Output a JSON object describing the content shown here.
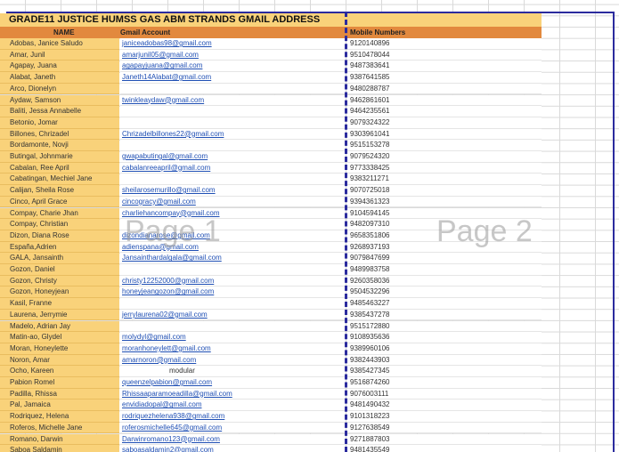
{
  "title": "GRADE11 JUSTICE HUMSS GAS ABM STRANDS GMAIL ADDRESS",
  "headers": {
    "name": "NAME",
    "gmail": "Gmail Account",
    "mobile": "Mobile Numbers"
  },
  "watermarks": {
    "page1": "Page 1",
    "page2": "Page 2"
  },
  "rows": [
    {
      "name": "Adobas, Janice Saludo",
      "gmail": "janiceadobas98@gmail.com",
      "mobile": "9120140896"
    },
    {
      "name": "Amar, Junil",
      "gmail": "amarjunil05@gmail.com",
      "mobile": "9510478044"
    },
    {
      "name": "Agapay, Juana",
      "gmail": "agapayjuana@gmail.com",
      "mobile": "9487383641"
    },
    {
      "name": "Alabat, Janeth",
      "gmail": "Janeth14Alabat@gmail.com",
      "mobile": "9387641585"
    },
    {
      "name": "Arco, Dionelyn",
      "gmail": "",
      "mobile": "9480288787"
    },
    {
      "name": "Aydaw, Samson",
      "gmail": "twinkleaydaw@gmail.com",
      "mobile": "9462861601"
    },
    {
      "name": "Baliti, Jessa Annabelle",
      "gmail": "",
      "mobile": "9464235561"
    },
    {
      "name": "Betonio, Jomar",
      "gmail": "",
      "mobile": "9079324322"
    },
    {
      "name": "Billones, Chrizadel",
      "gmail": "Chrizadelbillones22@gmail.com",
      "mobile": "9303961041"
    },
    {
      "name": "Bordamonte, Novji",
      "gmail": "",
      "mobile": "9515153278"
    },
    {
      "name": "Butingal, Johnmarie",
      "gmail": "gwapabutingal@gmail.com",
      "mobile": "9079524320"
    },
    {
      "name": "Cabalan, Ree April",
      "gmail": "cabalanreeapril@gmail.com",
      "mobile": "9773338425"
    },
    {
      "name": "Cabatingan, Mechiel Jane",
      "gmail": "",
      "mobile": "9383211271"
    },
    {
      "name": "Calijan, Sheila Rose",
      "gmail": "sheilarosemurillo@gmail.com",
      "mobile": "9070725018"
    },
    {
      "name": "Cinco, April Grace",
      "gmail": "cincogracy@gmail.com",
      "mobile": "9394361323"
    },
    {
      "name": "Compay, Charie Jhan",
      "gmail": "charliehancompay@gmail.com",
      "mobile": "9104594145"
    },
    {
      "name": "Compay, Christian",
      "gmail": "",
      "mobile": "9482097310"
    },
    {
      "name": "Dizon, Diana Rose",
      "gmail": "dizondianarose@gmail.com",
      "mobile": "9658351806"
    },
    {
      "name": "España,Adrien",
      "gmail": "adienspana@gmail.com",
      "mobile": "9268937193"
    },
    {
      "name": "GALA, Jansainth",
      "gmail": "Jansainthardalgala@gmail.com",
      "mobile": "9079847699"
    },
    {
      "name": "Gozon, Daniel",
      "gmail": "",
      "mobile": "9489983758"
    },
    {
      "name": "Gozon, Christy",
      "gmail": "christy12252000@gmail.com",
      "mobile": "9260358036"
    },
    {
      "name": "Gozon, Honeyjean",
      "gmail": "honeyjeangozon@gmail.com",
      "mobile": "9504532296"
    },
    {
      "name": "Kasil, Franne",
      "gmail": "",
      "mobile": "9485463227"
    },
    {
      "name": "Laurena, Jerrymie",
      "gmail": "jerrylaurena02@gmail.com",
      "mobile": "9385437278"
    },
    {
      "name": "Madelo, Adrian Jay",
      "gmail": "",
      "mobile": "9515172880"
    },
    {
      "name": "Matin-ao, Glydel",
      "gmail": "molydyl@gmail.com",
      "mobile": "9108935636"
    },
    {
      "name": "Moran, Honeylette",
      "gmail": "moranhoneylett@gmail.com",
      "mobile": "9389960106"
    },
    {
      "name": "Noron, Amar",
      "gmail": "amarnoron@gmail.com",
      "mobile": "9382443903"
    },
    {
      "name": "Ocho, Kareen",
      "gmail": "modular",
      "mobile": "9385427345"
    },
    {
      "name": "Pabion Romel",
      "gmail": "queenzelpabion@gmail.com",
      "mobile": "9516874260"
    },
    {
      "name": "Padilla, Rhissa",
      "gmail": "Rhissaaparamoeadilla@gmail.com",
      "mobile": "9076003111"
    },
    {
      "name": "Pal, Jamaica",
      "gmail": "envidiadopal@gmail.com",
      "mobile": "9481490432"
    },
    {
      "name": "Rodriquez, Helena",
      "gmail": "rodriquezhelena938@gmail.com",
      "mobile": "9101318223"
    },
    {
      "name": "Roferos, Michelle Jane",
      "gmail": "roferosmichelle645@gmail.com",
      "mobile": "9127638549"
    },
    {
      "name": "Romano, Darwin",
      "gmail": "Darwinromano123@gmail.com",
      "mobile": "9271887803"
    },
    {
      "name": "Saboa Saldamin",
      "gmail": "saboasaldamin2@gmail.com",
      "mobile": "9481435549"
    }
  ]
}
